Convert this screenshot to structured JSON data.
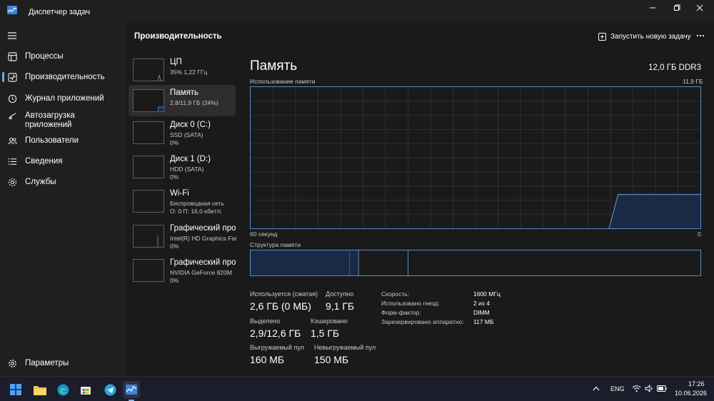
{
  "window": {
    "title": "Диспетчер задач"
  },
  "nav": {
    "items": [
      {
        "label": "Процессы",
        "icon": "processes-icon"
      },
      {
        "label": "Производительность",
        "icon": "performance-icon"
      },
      {
        "label": "Журнал приложений",
        "icon": "app-history-icon"
      },
      {
        "label": "Автозагрузка приложений",
        "icon": "startup-icon"
      },
      {
        "label": "Пользователи",
        "icon": "users-icon"
      },
      {
        "label": "Сведения",
        "icon": "details-icon"
      },
      {
        "label": "Службы",
        "icon": "services-icon"
      }
    ],
    "settings": "Параметры",
    "active": "Производительность"
  },
  "header": {
    "title": "Производительность",
    "run_task": "Запустить новую задачу",
    "more": "···"
  },
  "perf_list": [
    {
      "name": "ЦП",
      "lines": [
        "35%  1,22 ГГц"
      ],
      "color": "#2f8fd8"
    },
    {
      "name": "Память",
      "lines": [
        "2,8/11,9 ГБ (24%)"
      ],
      "color": "#2f8fd8"
    },
    {
      "name": "Диск 0 (C:)",
      "lines": [
        "SSD (SATA)",
        "0%"
      ],
      "color": "#4caf50"
    },
    {
      "name": "Диск 1 (D:)",
      "lines": [
        "HDD (SATA)",
        "0%"
      ],
      "color": "#4caf50"
    },
    {
      "name": "Wi-Fi",
      "lines": [
        "Беспроводная сеть",
        "О: 0 П: 16,0 кбит/с"
      ],
      "color": "#c2185b"
    },
    {
      "name": "Графический про",
      "lines": [
        "Intel(R) HD Graphics Far",
        "0%"
      ],
      "color": "#8e4fb8"
    },
    {
      "name": "Графический про",
      "lines": [
        "NVIDIA GeForce 820M",
        "0%"
      ],
      "color": "#8e4fb8"
    }
  ],
  "detail": {
    "title": "Память",
    "spec": "12,0 ГБ DDR3",
    "usage_label": "Использование памяти",
    "usage_max": "11,9 ГБ",
    "time_label": "60 секунд",
    "time_zero": "0",
    "structure_label": "Структура памяти",
    "stats": {
      "in_use_label": "Используется (сжатая)",
      "in_use_value": "2,6 ГБ (0 МБ)",
      "available_label": "Доступно",
      "available_value": "9,1 ГБ",
      "committed_label": "Выделено",
      "committed_value": "2,9/12,6 ГБ",
      "cached_label": "Кэшировано",
      "cached_value": "1,5 ГБ",
      "paged_label": "Выгружаемый пул",
      "paged_value": "160 МБ",
      "nonpaged_label": "Невыгружаемый пул",
      "nonpaged_value": "150 МБ"
    },
    "props": [
      {
        "label": "Скорость:",
        "value": "1600 МГц"
      },
      {
        "label": "Использовано гнезд:",
        "value": "2 из 4"
      },
      {
        "label": "Форм-фактор:",
        "value": "DIMM"
      },
      {
        "label": "Зарезервировано аппаратно:",
        "value": "117 МБ"
      }
    ]
  },
  "graph_data": {
    "memory_usage_fraction": 0.24,
    "structure_fractions": {
      "in_use": 0.22,
      "modified": 0.02,
      "standby": 0.11,
      "free": 0.65
    }
  },
  "taskbar": {
    "language": "ENG",
    "time": "17:26",
    "date": "10.06.2026"
  },
  "colors": {
    "accent": "#5fb2f2",
    "memory_line": "#5a8bc0",
    "memory_fill": "#1a2a45",
    "background": "#1c1c1c"
  }
}
